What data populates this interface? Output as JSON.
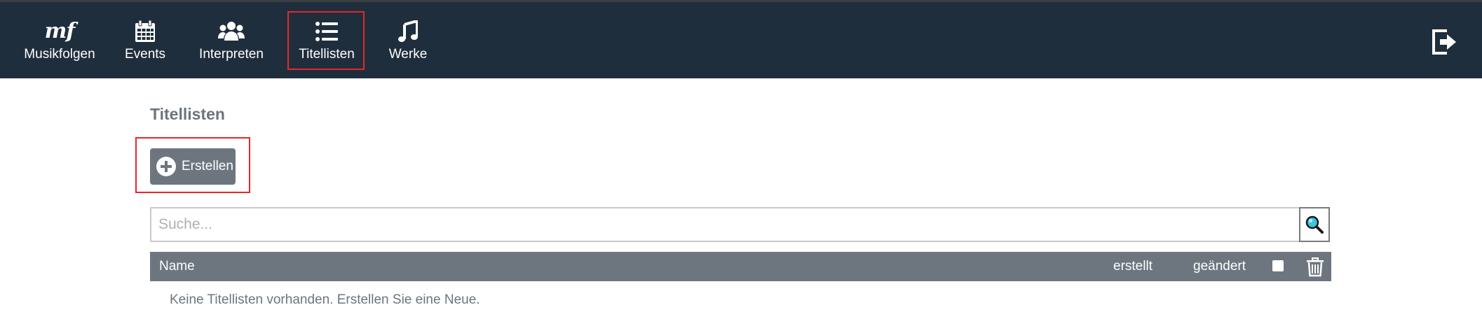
{
  "nav": {
    "items": [
      {
        "label": "Musikfolgen",
        "icon": "mf",
        "icon_name": "musikfolgen-logo-icon"
      },
      {
        "label": "Events",
        "icon_name": "calendar-icon"
      },
      {
        "label": "Interpreten",
        "icon_name": "users-icon"
      },
      {
        "label": "Titellisten",
        "icon_name": "list-icon",
        "highlighted": true
      },
      {
        "label": "Werke",
        "icon_name": "music-note-icon"
      }
    ],
    "logout_icon": "sign-out-icon"
  },
  "main": {
    "title": "Titellisten",
    "create_button": {
      "label": "Erstellen",
      "icon": "plus-circle-icon",
      "highlighted": true
    },
    "search": {
      "placeholder": "Suche...",
      "value": "",
      "button_icon": "magnifier-icon"
    },
    "table": {
      "columns": {
        "name": "Name",
        "created": "erstellt",
        "changed": "geändert"
      },
      "select_all_icon": "checkbox-icon",
      "delete_icon": "trash-icon",
      "rows": [],
      "empty_message": "Keine Titellisten vorhanden. Erstellen Sie eine Neue."
    }
  },
  "colors": {
    "navbar_bg": "#1f2e3c",
    "highlight": "#e8262b",
    "table_header_bg": "#6d767f",
    "muted_text": "#6c757d"
  }
}
